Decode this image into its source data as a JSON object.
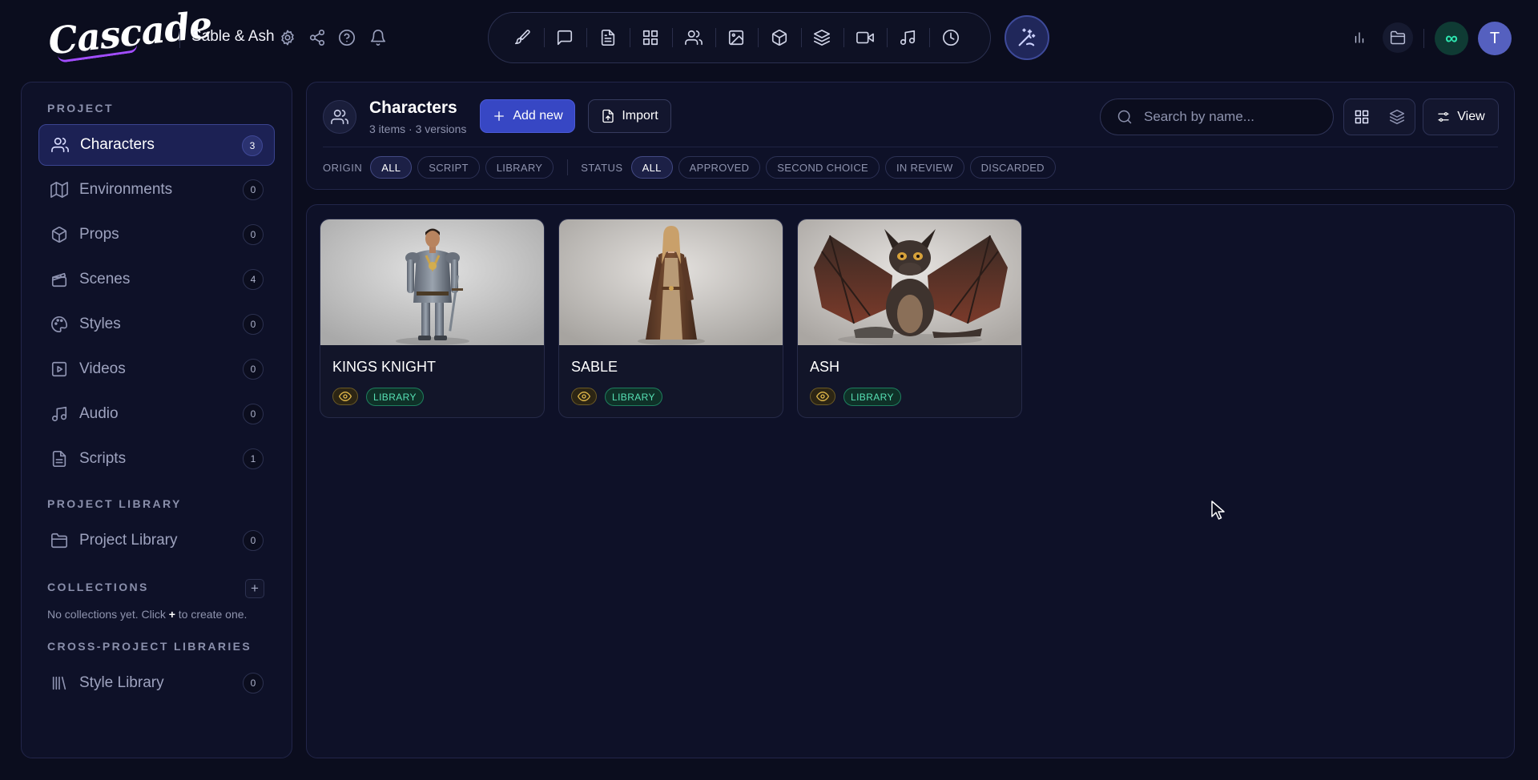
{
  "app": {
    "logo": "Cascade",
    "project_name": "Sable & Ash"
  },
  "colors": {
    "background": "#0b0d1e",
    "panel": "#0e1128",
    "accent": "#3747c4",
    "library_badge": "#57e0b4",
    "review_badge": "#e2b94b",
    "avatar": "#5560bf",
    "infinite": "#2ee6b0"
  },
  "topbar": {
    "icons": [
      "settings-icon",
      "share-icon",
      "help-icon",
      "bell-icon"
    ],
    "tools": [
      "brush-icon",
      "chat-icon",
      "document-icon",
      "grid-icon",
      "users-icon",
      "image-icon",
      "cube-icon",
      "layers-icon",
      "video-icon",
      "music-icon",
      "clock-icon"
    ],
    "magic_tool": "magic-wand-icon",
    "right_icons": [
      "analytics-icon",
      "folder-icon",
      "infinite-icon"
    ],
    "avatar_initial": "T"
  },
  "sidebar": {
    "project_label": "PROJECT",
    "items": [
      {
        "label": "Characters",
        "count": "3",
        "icon": "users-icon"
      },
      {
        "label": "Environments",
        "count": "0",
        "icon": "map-icon"
      },
      {
        "label": "Props",
        "count": "0",
        "icon": "cube-icon"
      },
      {
        "label": "Scenes",
        "count": "4",
        "icon": "clapper-icon"
      },
      {
        "label": "Styles",
        "count": "0",
        "icon": "palette-icon"
      },
      {
        "label": "Videos",
        "count": "0",
        "icon": "video-icon"
      },
      {
        "label": "Audio",
        "count": "0",
        "icon": "music-icon"
      },
      {
        "label": "Scripts",
        "count": "1",
        "icon": "document-icon"
      }
    ],
    "project_library_label": "PROJECT LIBRARY",
    "project_library_item": {
      "label": "Project Library",
      "count": "0"
    },
    "collections_label": "COLLECTIONS",
    "collections_empty_pre": "No collections yet. Click ",
    "collections_empty_plus": "+",
    "collections_empty_post": " to create one.",
    "cross_label": "CROSS-PROJECT LIBRARIES",
    "cross_item": {
      "label": "Style Library",
      "count": "0"
    }
  },
  "header": {
    "title": "Characters",
    "subtitle": "3 items · 3 versions",
    "add_label": "Add new",
    "import_label": "Import",
    "search_placeholder": "Search by name...",
    "view_label": "View",
    "origin_label": "ORIGIN",
    "origin_filters": [
      "ALL",
      "SCRIPT",
      "LIBRARY"
    ],
    "status_label": "STATUS",
    "status_filters": [
      "ALL",
      "APPROVED",
      "SECOND CHOICE",
      "IN REVIEW",
      "DISCARDED"
    ]
  },
  "cards": [
    {
      "name": "KINGS KNIGHT",
      "badge": "LIBRARY"
    },
    {
      "name": "SABLE",
      "badge": "LIBRARY"
    },
    {
      "name": "ASH",
      "badge": "LIBRARY"
    }
  ]
}
